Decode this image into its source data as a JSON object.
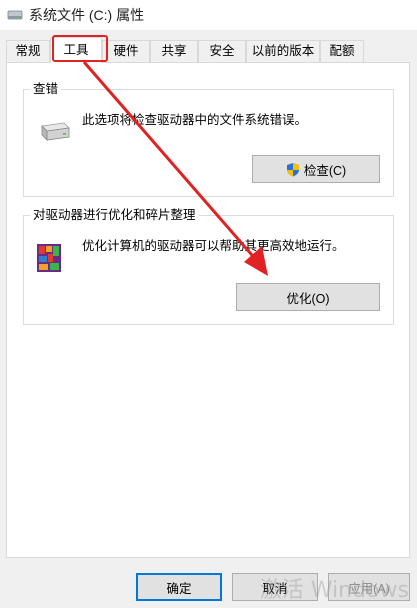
{
  "window": {
    "title": "系统文件 (C:) 属性",
    "icon": "drive-icon"
  },
  "tabs": [
    {
      "label": "常规"
    },
    {
      "label": "工具",
      "active": true
    },
    {
      "label": "硬件"
    },
    {
      "label": "共享"
    },
    {
      "label": "安全"
    },
    {
      "label": "以前的版本"
    },
    {
      "label": "配额"
    }
  ],
  "error_check": {
    "title": "查错",
    "description": "此选项将检查驱动器中的文件系统错误。",
    "button_label": "检查(C)",
    "button_icon": "shield-icon",
    "icon": "hard-drive-icon"
  },
  "optimize": {
    "title": "对驱动器进行优化和碎片整理",
    "description": "优化计算机的驱动器可以帮助其更高效地运行。",
    "button_label": "优化(O)",
    "icon": "defrag-icon"
  },
  "footer": {
    "ok_label": "确定",
    "cancel_label": "取消",
    "apply_label": "应用(A)"
  },
  "watermark": "激活 Windows",
  "colors": {
    "annotation": "#e02222",
    "accent": "#0078d7"
  }
}
